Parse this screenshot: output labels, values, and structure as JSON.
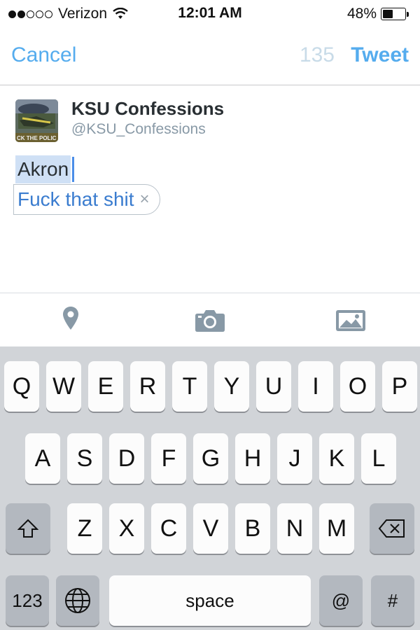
{
  "status_bar": {
    "carrier": "Verizon",
    "time": "12:01 AM",
    "battery_text": "48%",
    "battery_level": 0.48,
    "signal_bars_filled": 2,
    "signal_bars_total": 5
  },
  "nav": {
    "cancel_label": "Cancel",
    "char_count": "135",
    "tweet_label": "Tweet"
  },
  "account": {
    "name": "KSU Confessions",
    "handle": "@KSU_Confessions",
    "avatar_caption": "CK THE POLIC"
  },
  "compose": {
    "text": "Akron",
    "suggestion": "Fuck that shit",
    "suggestion_dismiss": "×"
  },
  "toolbar": {
    "icons": [
      "location-pin-icon",
      "camera-icon",
      "photo-library-icon"
    ]
  },
  "keyboard": {
    "row1": [
      "Q",
      "W",
      "E",
      "R",
      "T",
      "Y",
      "U",
      "I",
      "O",
      "P"
    ],
    "row2": [
      "A",
      "S",
      "D",
      "F",
      "G",
      "H",
      "J",
      "K",
      "L"
    ],
    "row3": [
      "Z",
      "X",
      "C",
      "V",
      "B",
      "N",
      "M"
    ],
    "numbers_label": "123",
    "space_label": "space",
    "at_label": "@",
    "hash_label": "#"
  },
  "colors": {
    "accent": "#55acee",
    "selection": "#cfe0f5",
    "keyboard_bg": "#d1d4d8"
  }
}
